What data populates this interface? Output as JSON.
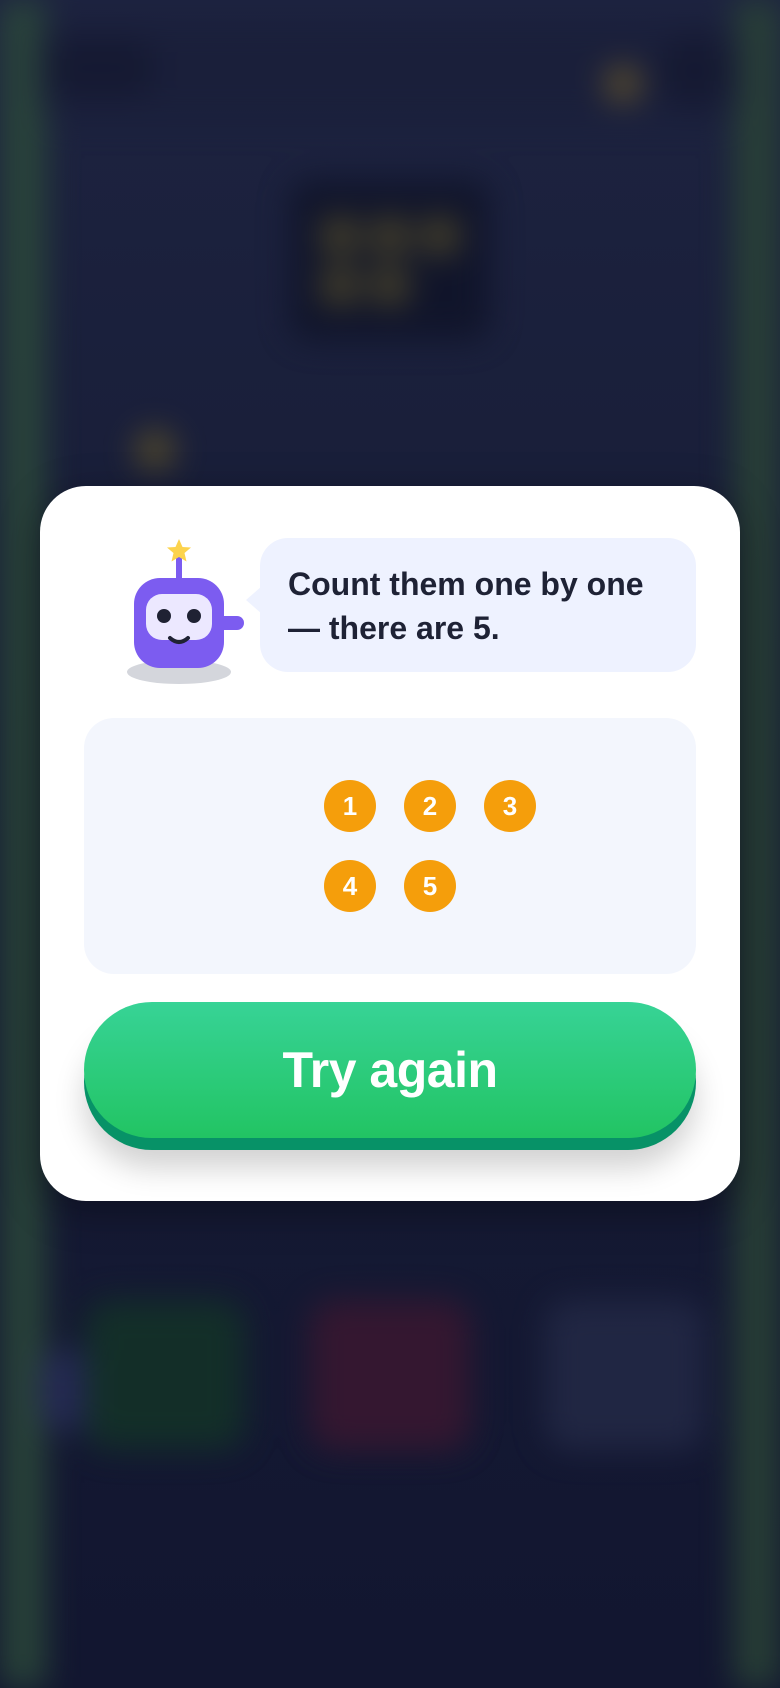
{
  "feedback": {
    "message": "Count them one by one — there are 5.",
    "count_labels": [
      "1",
      "2",
      "3",
      "4",
      "5"
    ],
    "retry_label": "Try again"
  },
  "colors": {
    "dot": "#f59e0b",
    "button_top": "#37d396",
    "button_bottom": "#22c463",
    "button_edge": "#079267",
    "bubble": "#eef2ff",
    "mascot": "#7c5cf0",
    "star": "#fcd34d"
  },
  "icons": {
    "mascot": "robot-mascot-icon",
    "star": "star-icon"
  }
}
